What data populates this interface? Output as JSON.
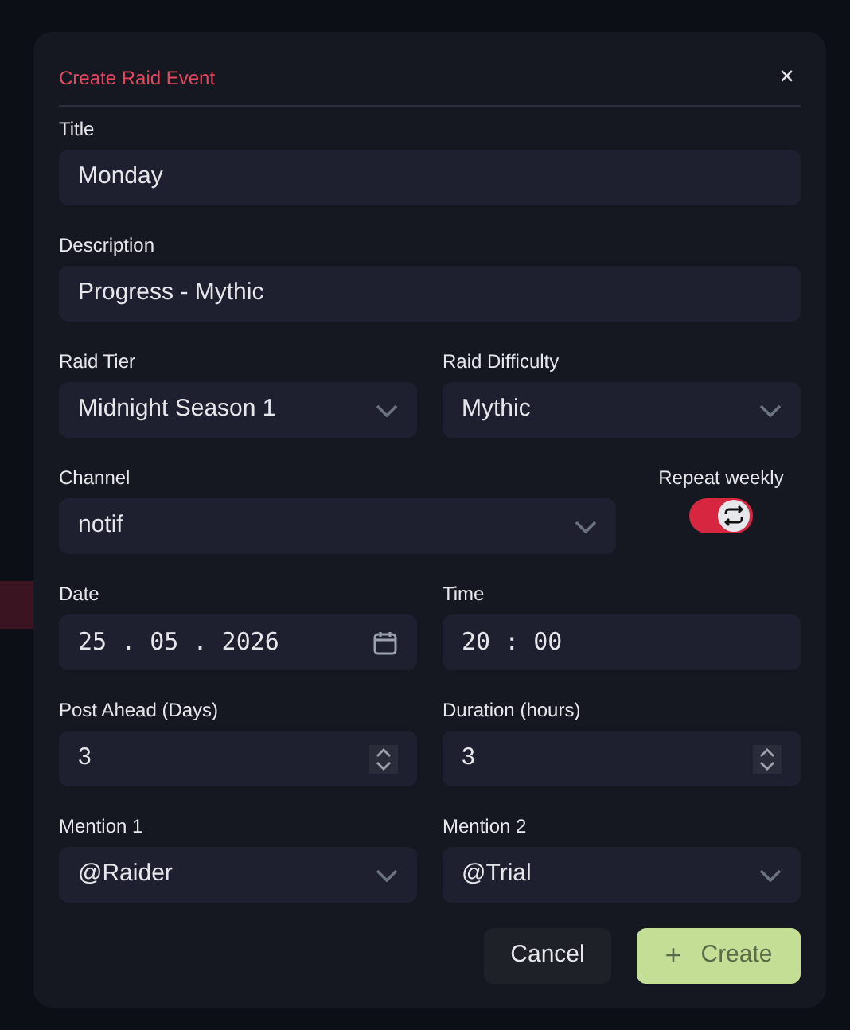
{
  "dialog": {
    "title": "Create Raid Event",
    "close": "×"
  },
  "rows": [
    {
      "fields": [
        {
          "kind": "text",
          "label": "Title",
          "value": "Monday"
        }
      ]
    },
    {
      "fields": [
        {
          "kind": "text",
          "label": "Description",
          "value": "Progress - Mythic"
        }
      ]
    },
    {
      "fields": [
        {
          "kind": "select",
          "label": "Raid Tier",
          "value": "Midnight Season 1"
        },
        {
          "kind": "select",
          "label": "Raid Difficulty",
          "value": "Mythic"
        }
      ]
    },
    {
      "fields": [
        {
          "kind": "select",
          "label": "Channel",
          "value": "notif"
        },
        {
          "kind": "toggle",
          "label": "Repeat weekly",
          "on": true
        }
      ]
    },
    {
      "fields": [
        {
          "kind": "date",
          "label": "Date",
          "value": "25 . 05 . 2026"
        },
        {
          "kind": "time",
          "label": "Time",
          "value": "20 : 00"
        }
      ]
    },
    {
      "fields": [
        {
          "kind": "number",
          "label": "Post Ahead (Days)",
          "value": "3"
        },
        {
          "kind": "number",
          "label": "Duration (hours)",
          "value": "3"
        }
      ]
    },
    {
      "fields": [
        {
          "kind": "select",
          "label": "Mention 1",
          "value": "@Raider"
        },
        {
          "kind": "select",
          "label": "Mention 2",
          "value": "@Trial"
        }
      ]
    }
  ],
  "buttons": [
    {
      "kind": "secondary",
      "label": "Cancel"
    },
    {
      "kind": "primary",
      "label": "Create",
      "icon": "+"
    }
  ]
}
